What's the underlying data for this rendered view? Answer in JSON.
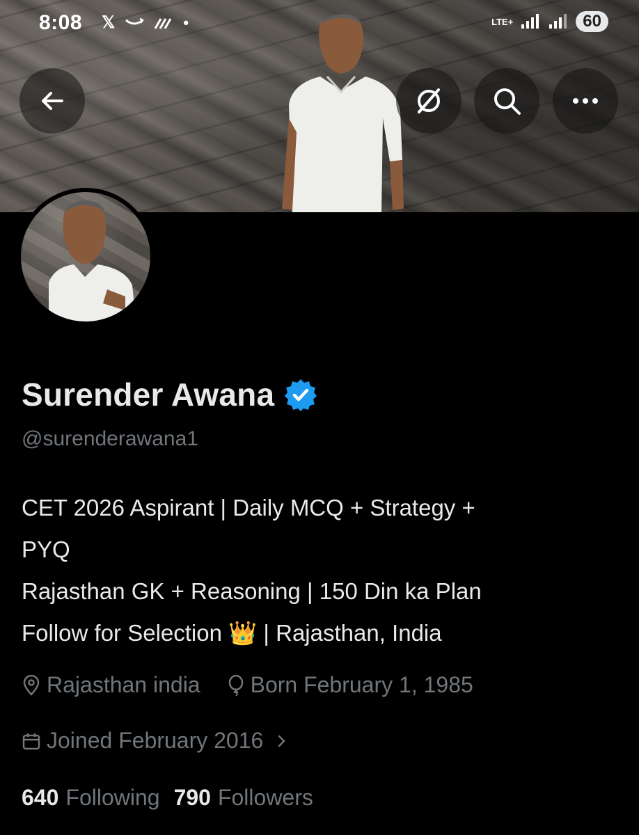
{
  "status_bar": {
    "time": "8:08",
    "network": "LTE+",
    "battery": "60",
    "left_icons": [
      "x-logo-icon",
      "amazon-smile-icon",
      "signal-stripes-icon",
      "dot-icon"
    ]
  },
  "header": {
    "back_icon": "arrow-left-icon",
    "actions": [
      "grok-icon",
      "search-icon",
      "more-icon"
    ]
  },
  "profile": {
    "name": "Surender Awana",
    "verified": true,
    "handle": "@surenderawana1",
    "bio_lines": [
      "CET 2026 Aspirant | Daily MCQ + Strategy +",
      "PYQ",
      "Rajasthan GK + Reasoning | 150 Din ka Plan",
      "Follow for Selection 👑 | Rajasthan, India"
    ],
    "location": "Rajasthan india",
    "born": "Born February 1, 1985",
    "joined": "Joined February 2016",
    "following_count": "640",
    "following_label": "Following",
    "followers_count": "790",
    "followers_label": "Followers"
  },
  "colors": {
    "background": "#000000",
    "text_primary": "#e7e9ea",
    "text_secondary": "#71767b",
    "verified_blue": "#1d9bf0"
  }
}
